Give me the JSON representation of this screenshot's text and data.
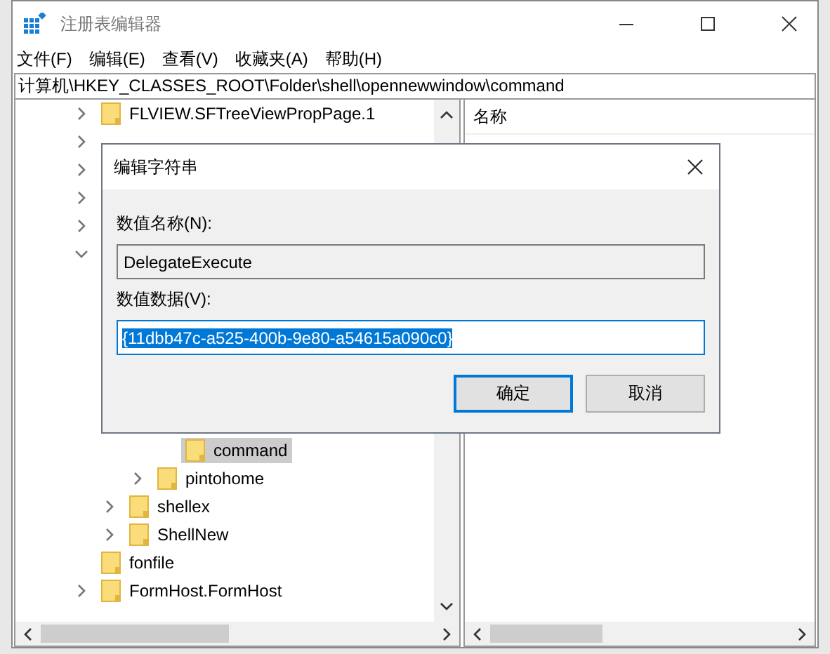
{
  "window": {
    "title": "注册表编辑器"
  },
  "menu": [
    "文件(F)",
    "编辑(E)",
    "查看(V)",
    "收藏夹(A)",
    "帮助(H)"
  ],
  "address": "计算机\\HKEY_CLASSES_ROOT\\Folder\\shell\\opennewwindow\\command",
  "tree": [
    {
      "label": "FLVIEW.SFTreeViewPropPage.1",
      "expanded": false,
      "selected": false
    },
    {
      "expanded": false
    },
    {
      "expanded": false
    },
    {
      "expanded": false
    },
    {
      "expanded": false
    },
    {
      "expanded": true,
      "children": [
        {
          "children": [
            {
              "children": [
                {
                  "label": "command",
                  "selected": true
                }
              ]
            },
            {
              "label": "pintohome",
              "expanded": false,
              "selected": false
            }
          ]
        },
        {
          "label": "shellex",
          "expanded": false,
          "selected": false
        },
        {
          "label": "ShellNew",
          "expanded": false,
          "selected": false
        }
      ]
    },
    {
      "label": "fonfile",
      "selected": false
    },
    {
      "label": "FormHost.FormHost",
      "expanded": false,
      "selected": false
    }
  ],
  "list": {
    "columns": [
      "名称"
    ]
  },
  "dialog": {
    "title": "编辑字符串",
    "name_label": "数值名称(N):",
    "name_value": "DelegateExecute",
    "data_label": "数值数据(V):",
    "data_value": "{11dbb47c-a525-400b-9e80-a54615a090c0}",
    "data_selected": true,
    "buttons": [
      {
        "label": "确定",
        "default": true
      },
      {
        "label": "取消",
        "default": false
      }
    ]
  }
}
